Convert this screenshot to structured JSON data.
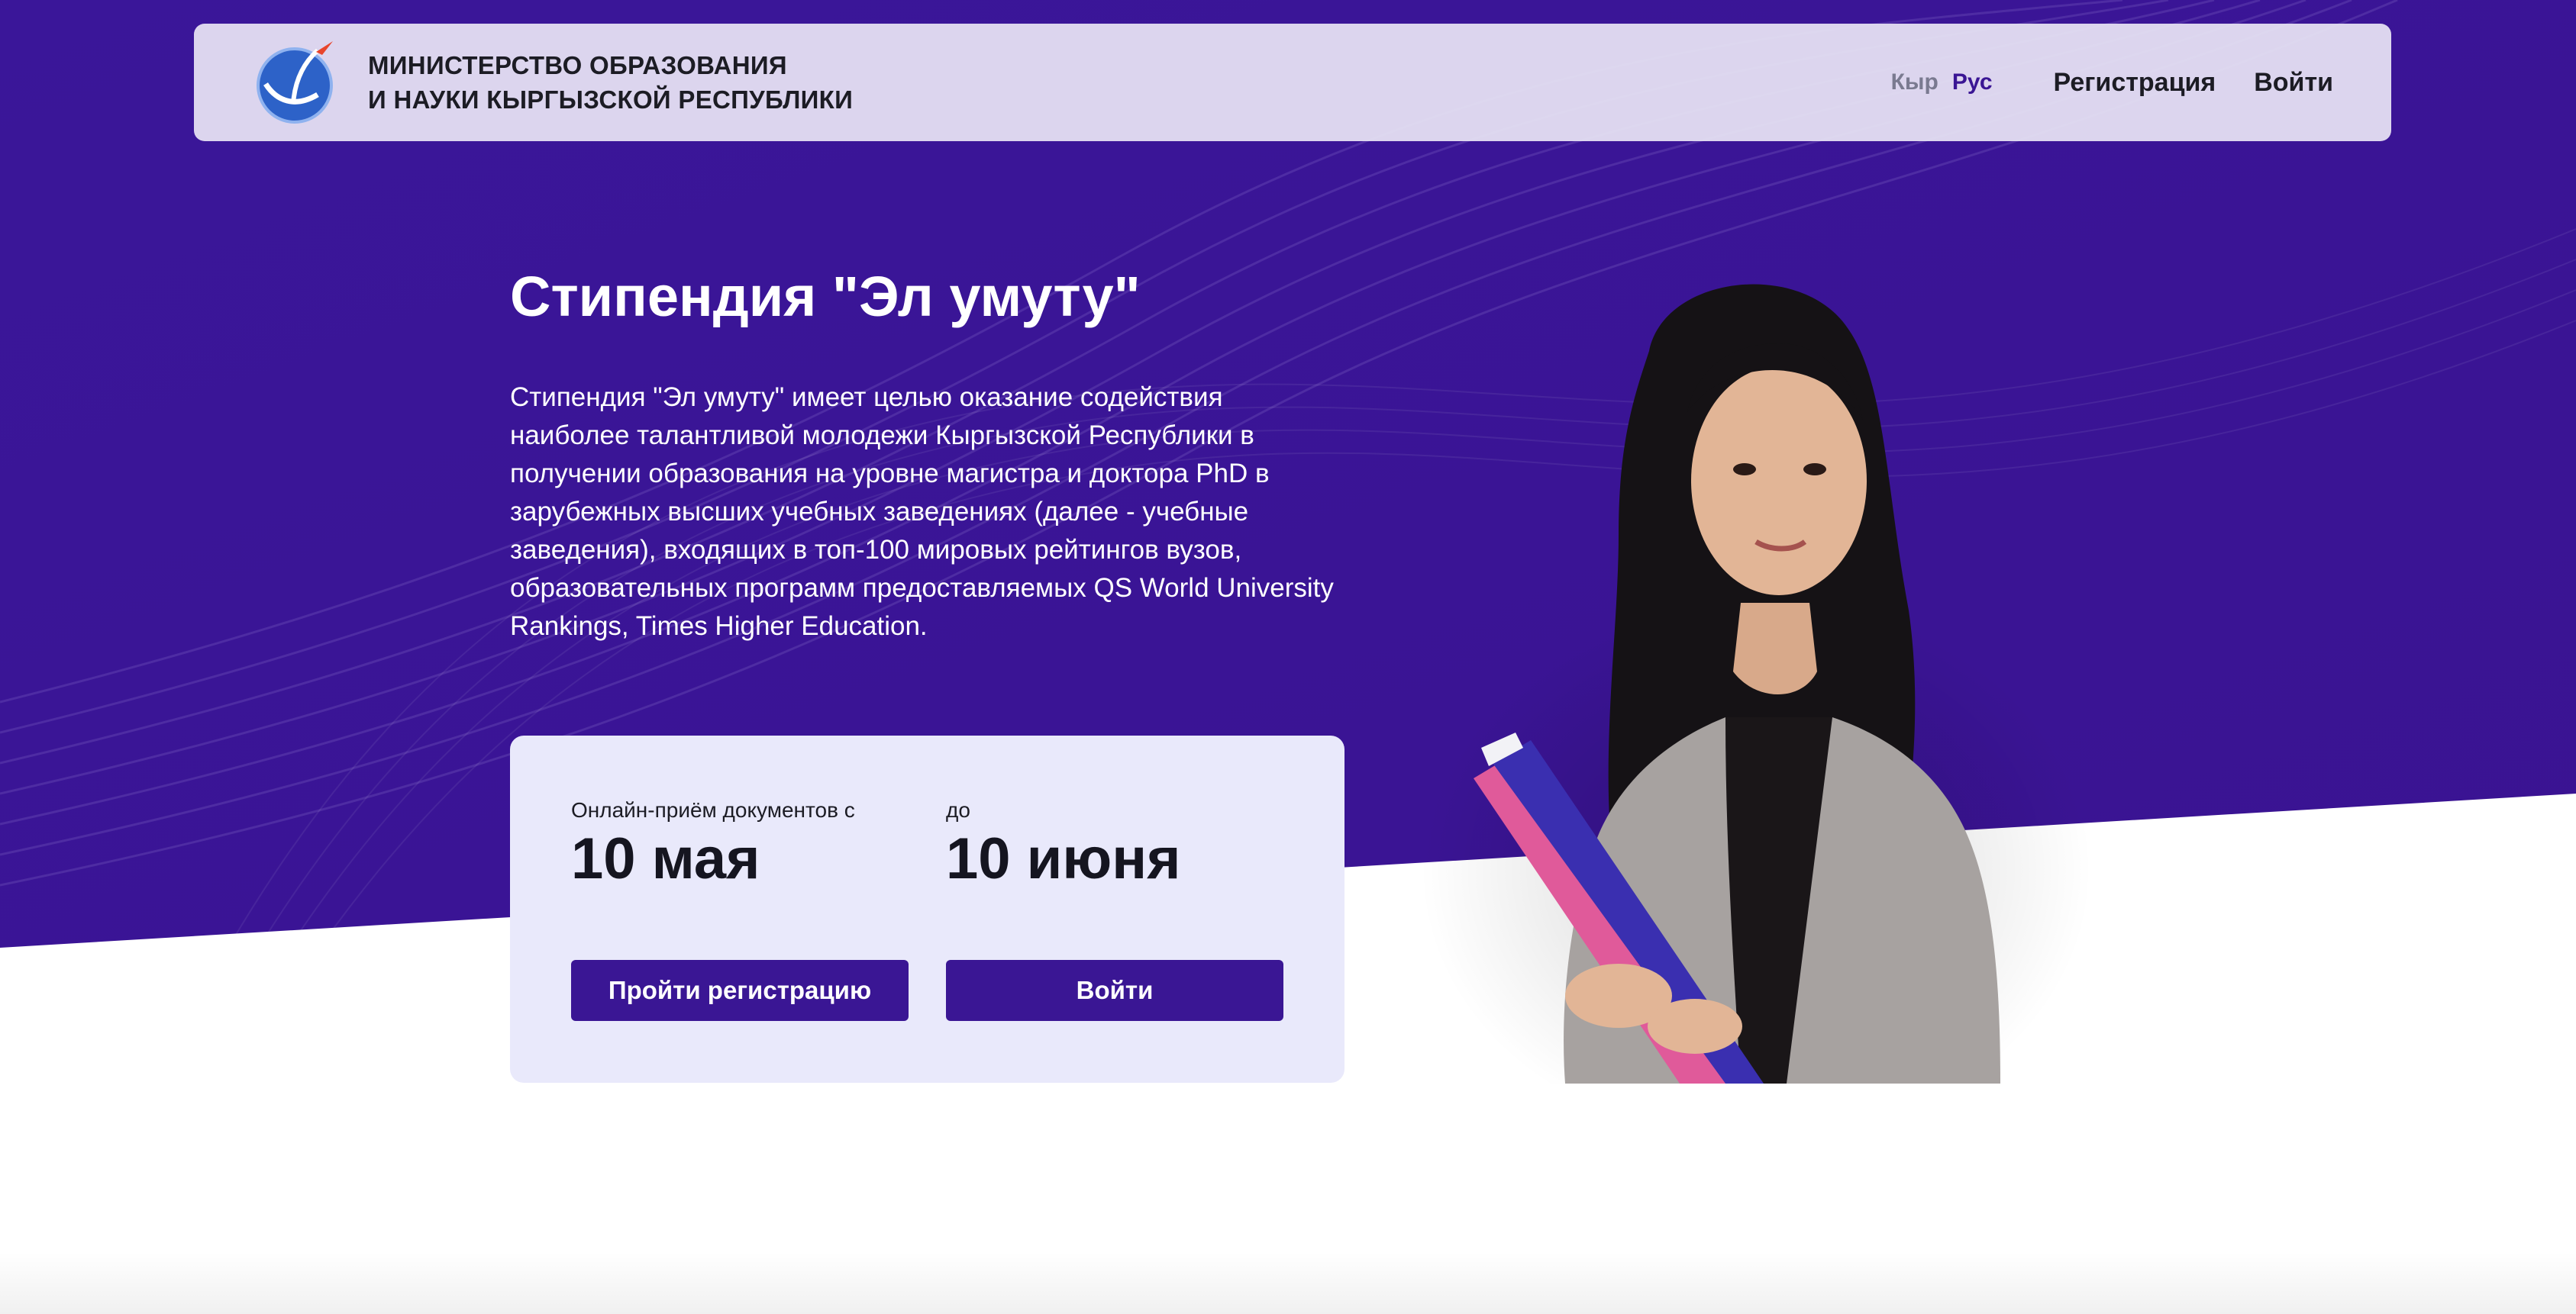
{
  "header": {
    "org_line1": "МИНИСТЕРСТВО ОБРАЗОВАНИЯ",
    "org_line2": "И НАУКИ КЫРГЫЗСКОЙ РЕСПУБЛИКИ",
    "lang_ky": "Кыр",
    "lang_ru": "Рус",
    "register_link": "Регистрация",
    "login_link": "Войти"
  },
  "hero": {
    "title": "Стипендия \"Эл умуту\"",
    "description": "Стипендия \"Эл умуту\" имеет целью оказание содействия наиболее талантливой молодежи Кыргызской Республики в получении образования на уровне магистра и доктора PhD в зарубежных высших учебных заведениях (далее - учебные заведения), входящих в топ-100 мировых рейтингов вузов, образовательных программ предоставляемых QS World University Rankings, Times Higher Education."
  },
  "card": {
    "start_label": "Онлайн-приём документов с",
    "start_date": "10 мая",
    "end_label": "до",
    "end_date": "10 июня",
    "register_button": "Пройти регистрацию",
    "login_button": "Войти"
  },
  "colors": {
    "brand_purple": "#3a1694",
    "card_bg": "#e9e9fb",
    "header_bg": "#e8e4f4"
  },
  "icons": {
    "logo": "ministry-emblem-icon"
  }
}
